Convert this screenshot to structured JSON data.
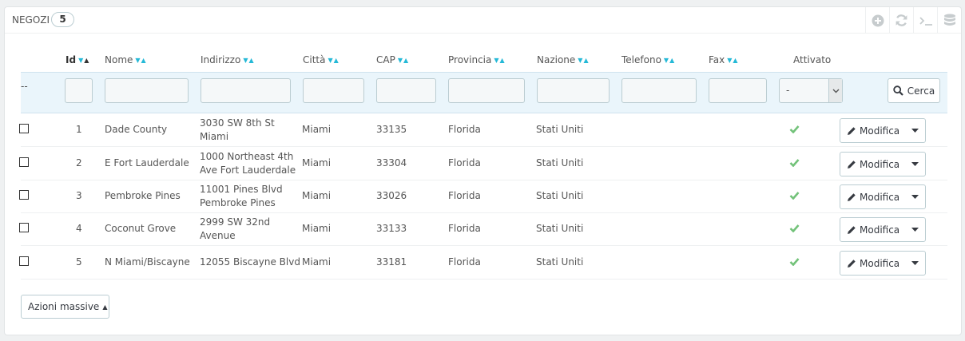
{
  "header": {
    "title": "NEGOZI",
    "count": "5",
    "toolbar": [
      {
        "name": "add-icon"
      },
      {
        "name": "refresh-icon"
      },
      {
        "name": "sql-terminal-icon"
      },
      {
        "name": "database-icon"
      }
    ]
  },
  "columns": {
    "id": "Id",
    "name": "Nome",
    "address": "Indirizzo",
    "city": "Città",
    "zip": "CAP",
    "state": "Provincia",
    "country": "Nazione",
    "phone": "Telefono",
    "fax": "Fax",
    "active": "Attivato"
  },
  "filters": {
    "bulk_placeholder": "--",
    "active_value": "-",
    "search_label": "Cerca"
  },
  "rows": [
    {
      "id": "1",
      "name": "Dade County",
      "address1": "3030 SW 8th St",
      "address2": "Miami",
      "city": "Miami",
      "zip": "33135",
      "state": "Florida",
      "country": "Stati Uniti",
      "action": "Modifica"
    },
    {
      "id": "2",
      "name": "E Fort Lauderdale",
      "address1": "1000 Northeast 4th",
      "address2": "Ave Fort Lauderdale",
      "city": "Miami",
      "zip": "33304",
      "state": "Florida",
      "country": "Stati Uniti",
      "action": "Modifica"
    },
    {
      "id": "3",
      "name": "Pembroke Pines",
      "address1": "11001 Pines Blvd",
      "address2": "Pembroke Pines",
      "city": "Miami",
      "zip": "33026",
      "state": "Florida",
      "country": "Stati Uniti",
      "action": "Modifica"
    },
    {
      "id": "4",
      "name": "Coconut Grove",
      "address1": "2999 SW 32nd",
      "address2": "Avenue",
      "city": "Miami",
      "zip": "33133",
      "state": "Florida",
      "country": "Stati Uniti",
      "action": "Modifica"
    },
    {
      "id": "5",
      "name": "N Miami/Biscayne",
      "address1": "12055 Biscayne Blvd",
      "address2": "",
      "city": "Miami",
      "zip": "33181",
      "state": "Florida",
      "country": "Stati Uniti",
      "action": "Modifica"
    }
  ],
  "footer": {
    "bulk_actions_label": "Azioni massive"
  },
  "colors": {
    "accent": "#25b9d7",
    "active_check": "#72c279",
    "filter_row_bg": "#eaf5fb"
  }
}
